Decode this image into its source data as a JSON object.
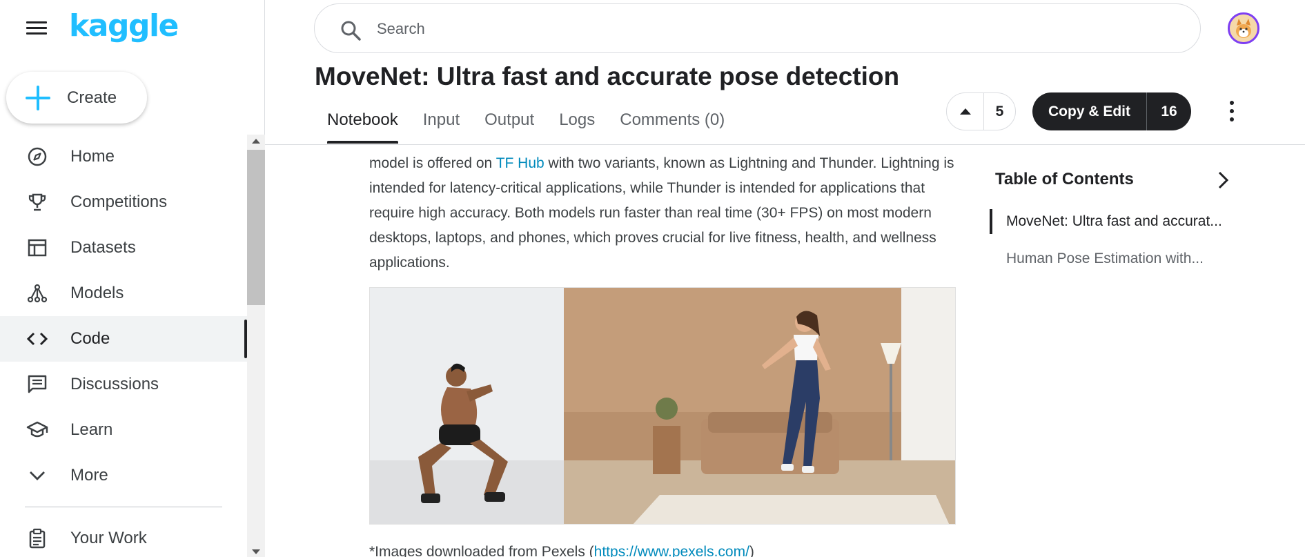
{
  "sidebar": {
    "logo": "kaggle",
    "create_label": "Create",
    "items": [
      {
        "label": "Home",
        "icon": "compass-icon"
      },
      {
        "label": "Competitions",
        "icon": "trophy-icon"
      },
      {
        "label": "Datasets",
        "icon": "table-icon"
      },
      {
        "label": "Models",
        "icon": "models-icon"
      },
      {
        "label": "Code",
        "icon": "code-icon",
        "active": true
      },
      {
        "label": "Discussions",
        "icon": "discussions-icon"
      },
      {
        "label": "Learn",
        "icon": "graduation-cap-icon"
      },
      {
        "label": "More",
        "icon": "chevron-down-icon"
      }
    ],
    "your_work_label": "Your Work"
  },
  "header": {
    "search_placeholder": "Search",
    "title": "MoveNet: Ultra fast and accurate pose detection",
    "tabs": [
      "Notebook",
      "Input",
      "Output",
      "Logs",
      "Comments (0)"
    ],
    "active_tab": "Notebook",
    "vote_count": "5",
    "copy_edit_label": "Copy & Edit",
    "copy_edit_count": "16"
  },
  "content": {
    "para_part1": "model is offered on ",
    "para_link": "TF Hub",
    "para_part2": " with two variants, known as Lightning and Thunder. Lightning is intended for latency-critical applications, while Thunder is intended for applications that require high accuracy. Both models run faster than real time (30+ FPS) on most modern desktops, laptops, and phones, which proves crucial for live fitness, health, and wellness applications.",
    "caption_prefix": "*Images downloaded from Pexels (",
    "caption_link": "https://www.pexels.com/",
    "caption_suffix": ")"
  },
  "toc": {
    "title": "Table of Contents",
    "items": [
      "MoveNet: Ultra fast and accurat...",
      "Human Pose Estimation with..."
    ]
  },
  "colors": {
    "brand": "#20beff",
    "link": "#008abc",
    "dark_button": "#202124",
    "avatar_ring": "#7e3ff2"
  }
}
